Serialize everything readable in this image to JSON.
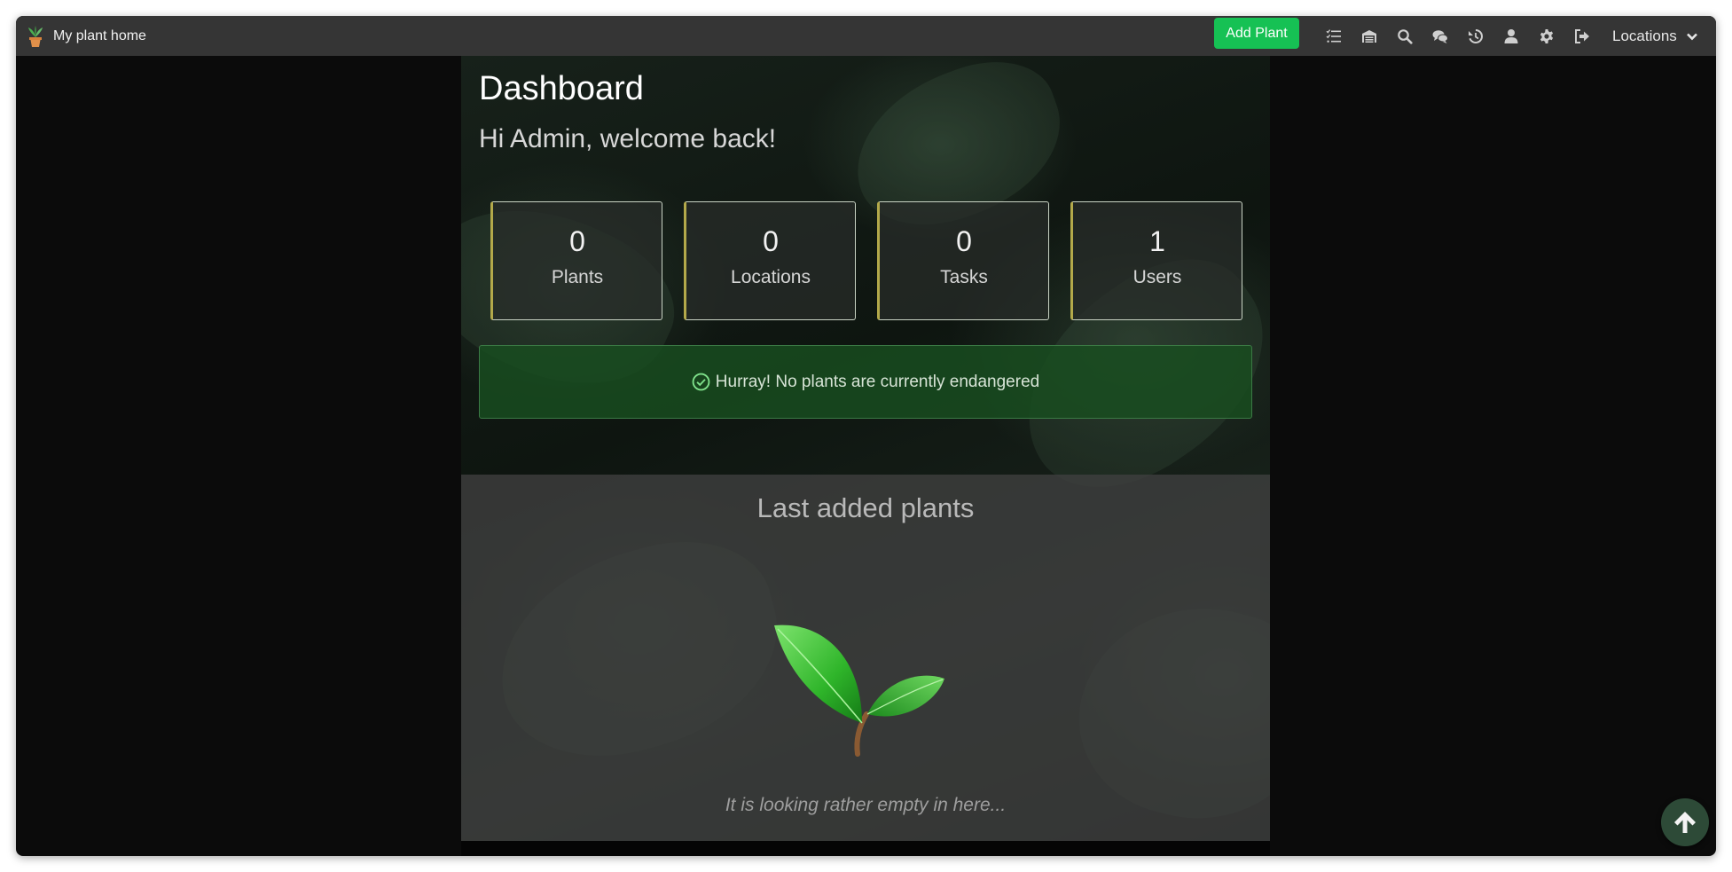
{
  "navbar": {
    "brand": "My plant home",
    "add_plant_label": "Add Plant",
    "icons": [
      "tasks-icon",
      "inventory-icon",
      "search-icon",
      "chat-icon",
      "history-icon",
      "user-icon",
      "gear-icon",
      "logout-icon"
    ],
    "locations_label": "Locations"
  },
  "main": {
    "title": "Dashboard",
    "welcome": "Hi Admin, welcome back!",
    "stats": [
      {
        "value": "0",
        "label": "Plants"
      },
      {
        "value": "0",
        "label": "Locations"
      },
      {
        "value": "0",
        "label": "Tasks"
      },
      {
        "value": "1",
        "label": "Users"
      }
    ],
    "alert": "Hurray! No plants are currently endangered",
    "last_added_title": "Last added plants",
    "empty_text": "It is looking rather empty in here..."
  },
  "colors": {
    "accent_green": "#16c154",
    "navbar_bg": "#353535",
    "alert_bg": "#184e20",
    "card_left_border": "#b3a94a"
  }
}
